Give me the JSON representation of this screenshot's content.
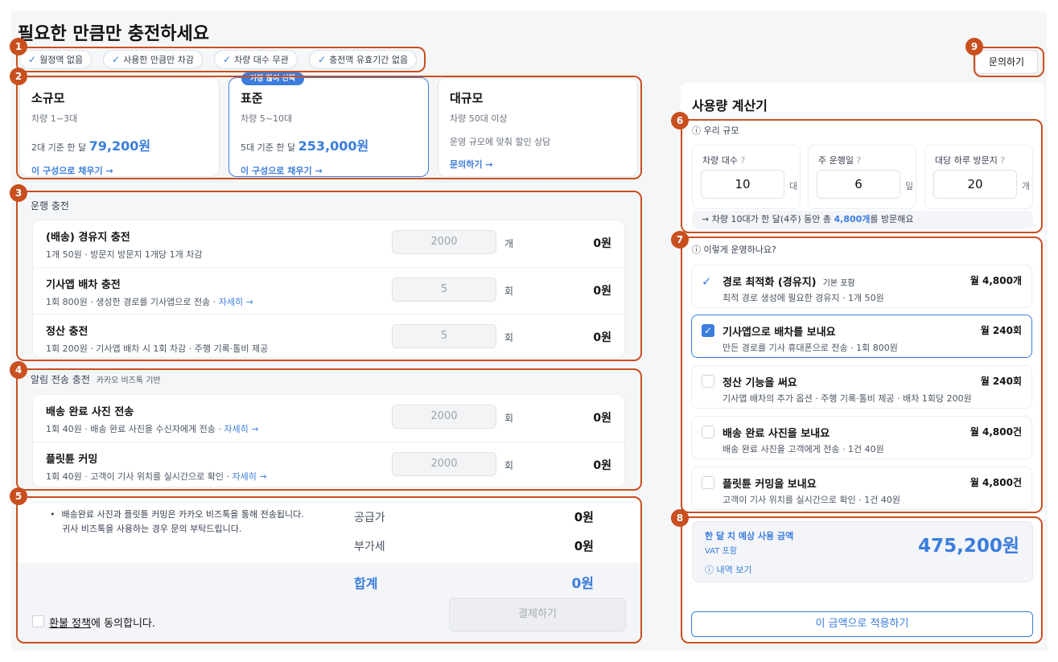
{
  "header": {
    "title": "필요한 만큼만 충전하세요",
    "contact_label": "문의하기"
  },
  "chips": [
    "월정액 없음",
    "사용한 만큼만 차감",
    "차량 대수 무관",
    "충전액 유효기간 없음"
  ],
  "plans": [
    {
      "name": "소규모",
      "scope": "차량 1~3대",
      "price_prefix": "2대 기준 한 달",
      "price": "79,200원",
      "link": "이 구성으로 채우기 →"
    },
    {
      "name": "표준",
      "badge": "가장 많이 선택",
      "scope": "차량 5~10대",
      "price_prefix": "5대 기준 한 달",
      "price": "253,000원",
      "link": "이 구성으로 채우기 →"
    },
    {
      "name": "대규모",
      "scope": "차량 50대 이상",
      "note": "운영 규모에 맞춰 할인 상담",
      "link": "문의하기 →"
    }
  ],
  "operation": {
    "label": "운행 충전",
    "rows": [
      {
        "title": "(배송) 경유지 충전",
        "desc": "1개 50원 · 방문지 방문지 1개당 1개 차감",
        "value": "2000",
        "unit": "개",
        "amount": "0원"
      },
      {
        "title": "기사앱 배차 충전",
        "desc": "1회 800원 · 생성한 경로를 기사앱으로 전송 · ",
        "link": "자세히 →",
        "value": "5",
        "unit": "회",
        "amount": "0원"
      },
      {
        "title": "정산 충전",
        "desc": "1회 200원 · 기사앱 배차 시 1회 차감 · 주행 기록·톨비 제공",
        "value": "5",
        "unit": "회",
        "amount": "0원"
      }
    ]
  },
  "notify": {
    "label": "알림 전송 충전",
    "sublabel": "카카오 비즈톡 기반",
    "rows": [
      {
        "title": "배송 완료 사진 전송",
        "desc": "1회 40원 · 배송 완료 사진을 수신자에게 전송 · ",
        "link": "자세히 →",
        "value": "2000",
        "unit": "회",
        "amount": "0원"
      },
      {
        "title": "플릿튠 커밍",
        "desc": "1회 40원 · 고객이 기사 위치를 실시간으로 확인 · ",
        "link": "자세히 →",
        "value": "2000",
        "unit": "회",
        "amount": "0원"
      }
    ]
  },
  "summary": {
    "note_line1": "배송완료 사진과 플릿튠 커밍은 카카오 비즈톡을 통해 전송됩니다.",
    "note_line2": "귀사 비즈톡을 사용하는 경우 문의 부탁드립니다.",
    "supply_label": "공급가",
    "supply_value": "0원",
    "vat_label": "부가세",
    "vat_value": "0원",
    "total_label": "합계",
    "total_value": "0원",
    "refund_link": "환불 정책",
    "refund_rest": "에 동의합니다.",
    "pay_label": "결제하기"
  },
  "calculator": {
    "title": "사용량 계산기",
    "scale_label": "우리 규모",
    "fields": [
      {
        "label": "차량 대수",
        "value": "10",
        "unit": "대"
      },
      {
        "label": "주 운행일",
        "value": "6",
        "unit": "일"
      },
      {
        "label": "대당 하루 방문지",
        "value": "20",
        "unit": "개"
      }
    ],
    "scale_summary_pre": "→ 차량 10대가 한 달(4주) 동안 총 ",
    "scale_summary_num": "4,800개",
    "scale_summary_post": "를 방문해요",
    "ops_label": "이렇게 운영하나요?",
    "options": [
      {
        "title": "경로 최적화 (경유지)",
        "tag": "기본 포함",
        "desc": "최적 경로 생성에 필요한 경유지 · 1개 50원",
        "qty": "월 4,800개",
        "state": "included"
      },
      {
        "title": "기사앱으로 배차를 보내요",
        "desc": "만든 경로를 기사 휴대폰으로 전송 · 1회 800원",
        "qty": "월 240회",
        "state": "checked"
      },
      {
        "title": "정산 기능을 써요",
        "desc": "기사앱 배차의 추가 옵션 · 주행 기록·톨비 제공 · 배차 1회당 200원",
        "qty": "월 240회",
        "state": "off"
      },
      {
        "title": "배송 완료 사진을 보내요",
        "desc": "배송 완료 사진을 고객에게 전송 · 1건 40원",
        "qty": "월 4,800건",
        "state": "off"
      },
      {
        "title": "플릿튠 커밍을 보내요",
        "desc": "고객이 기사 위치를 실시간으로 확인 · 1건 40원",
        "qty": "월 4,800건",
        "state": "off"
      }
    ],
    "estimate_label": "한 달 치 예상 사용 금액",
    "vat_note": "VAT 포함",
    "estimate_value": "475,200원",
    "detail_link": "내역 보기",
    "apply_label": "이 금액으로 적용하기"
  },
  "markers": [
    "1",
    "2",
    "3",
    "4",
    "5",
    "6",
    "7",
    "8",
    "9"
  ],
  "colors": {
    "accent": "#3b7ddd",
    "highlight": "#c94f1f"
  }
}
